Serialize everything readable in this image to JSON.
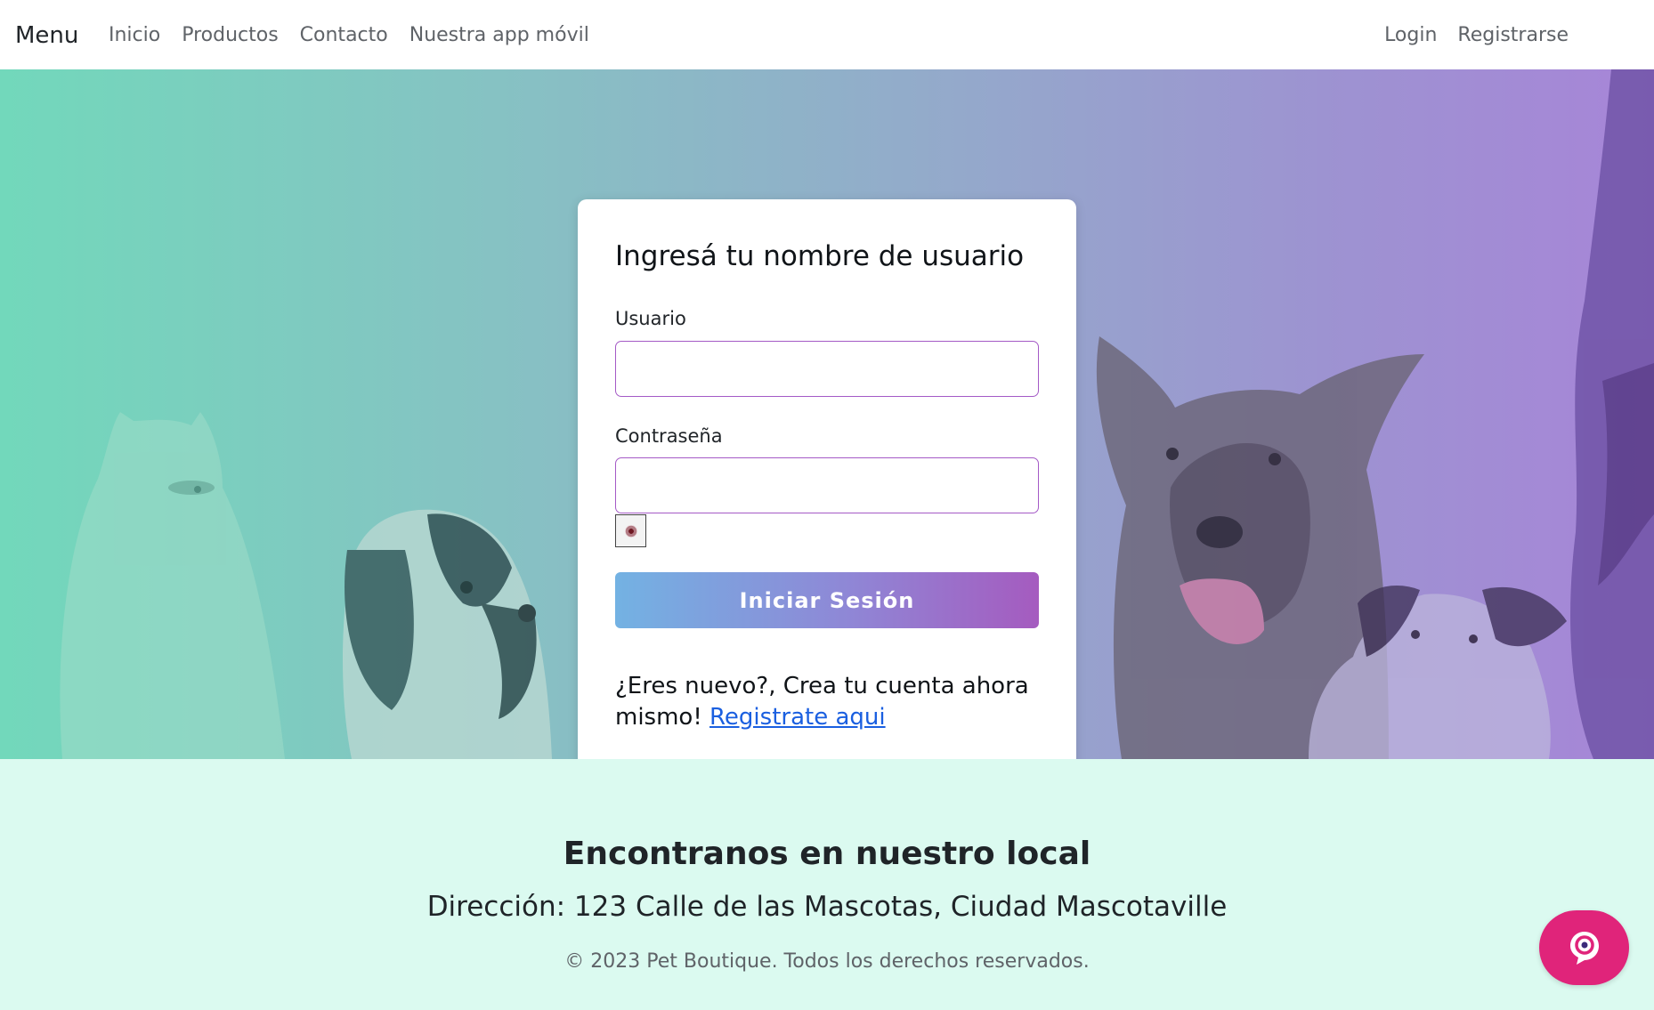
{
  "navbar": {
    "brand": "Menu",
    "links": [
      "Inicio",
      "Productos",
      "Contacto",
      "Nuestra app móvil"
    ],
    "auth_links": [
      "Login",
      "Registrarse"
    ]
  },
  "login": {
    "title": "Ingresá tu nombre de usuario",
    "username_label": "Usuario",
    "username_value": "",
    "password_label": "Contraseña",
    "password_value": "",
    "submit_label": "Iniciar Sesión",
    "signup_prompt": "¿Eres nuevo?, Crea tu cuenta ahora mismo!",
    "signup_link": "Registrate aqui",
    "toggle_icon": "eye-icon"
  },
  "footer": {
    "title": "Encontranos en nuestro local",
    "address": "Dirección: 123 Calle de las Mascotas, Ciudad Mascotaville",
    "copyright": "© 2023 Pet Boutique. Todos los derechos reservados."
  },
  "chat_widget": {
    "icon": "chat-bubble-icon",
    "color": "#e0247a"
  },
  "colors": {
    "accent_gradient_start": "#73b2e3",
    "accent_gradient_end": "#a55bbf",
    "link": "#1a5fe0",
    "footer_bg": "#dbfaf0",
    "input_border": "#a45ac6"
  }
}
